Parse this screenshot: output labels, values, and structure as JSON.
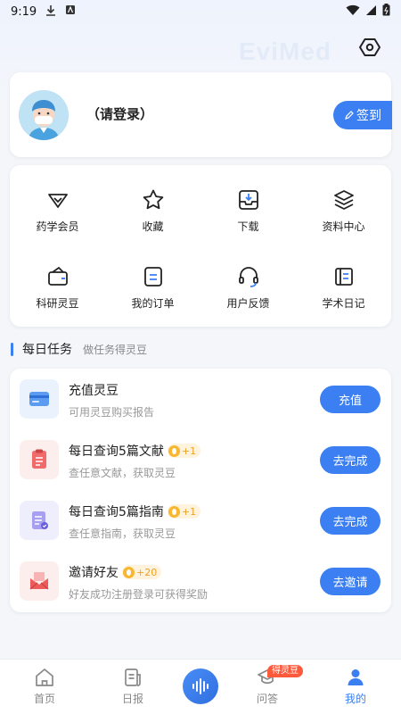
{
  "status_bar": {
    "time": "9:19"
  },
  "watermark": "EviMed",
  "profile": {
    "login_text": "（请登录）",
    "signin_label": "签到"
  },
  "features": [
    {
      "label": "药学会员",
      "icon": "vip-diamond-icon"
    },
    {
      "label": "收藏",
      "icon": "star-icon"
    },
    {
      "label": "下载",
      "icon": "download-box-icon"
    },
    {
      "label": "资料中心",
      "icon": "layers-icon"
    },
    {
      "label": "科研灵豆",
      "icon": "wallet-icon"
    },
    {
      "label": "我的订单",
      "icon": "order-list-icon"
    },
    {
      "label": "用户反馈",
      "icon": "headset-icon"
    },
    {
      "label": "学术日记",
      "icon": "diary-icon"
    }
  ],
  "daily": {
    "title": "每日任务",
    "subtitle": "做任务得灵豆"
  },
  "tasks": [
    {
      "title": "充值灵豆",
      "reward": "",
      "desc": "可用灵豆购买报告",
      "button": "充值",
      "icon": "recharge-card-icon"
    },
    {
      "title": "每日查询5篇文献",
      "reward": "+1",
      "desc": "查任意文献，获取灵豆",
      "button": "去完成",
      "icon": "document-icon"
    },
    {
      "title": "每日查询5篇指南",
      "reward": "+1",
      "desc": "查任意指南，获取灵豆",
      "button": "去完成",
      "icon": "guide-icon"
    },
    {
      "title": "邀请好友",
      "reward": "+20",
      "desc": "好友成功注册登录可获得奖励",
      "button": "去邀请",
      "icon": "invite-envelope-icon"
    }
  ],
  "nav": {
    "home": "首页",
    "daily": "日报",
    "qa": "问答",
    "qa_badge": "得灵豆",
    "mine": "我的"
  },
  "colors": {
    "accent": "#3b7ff2",
    "badge": "#ff5a3c",
    "reward": "#f0a020"
  }
}
